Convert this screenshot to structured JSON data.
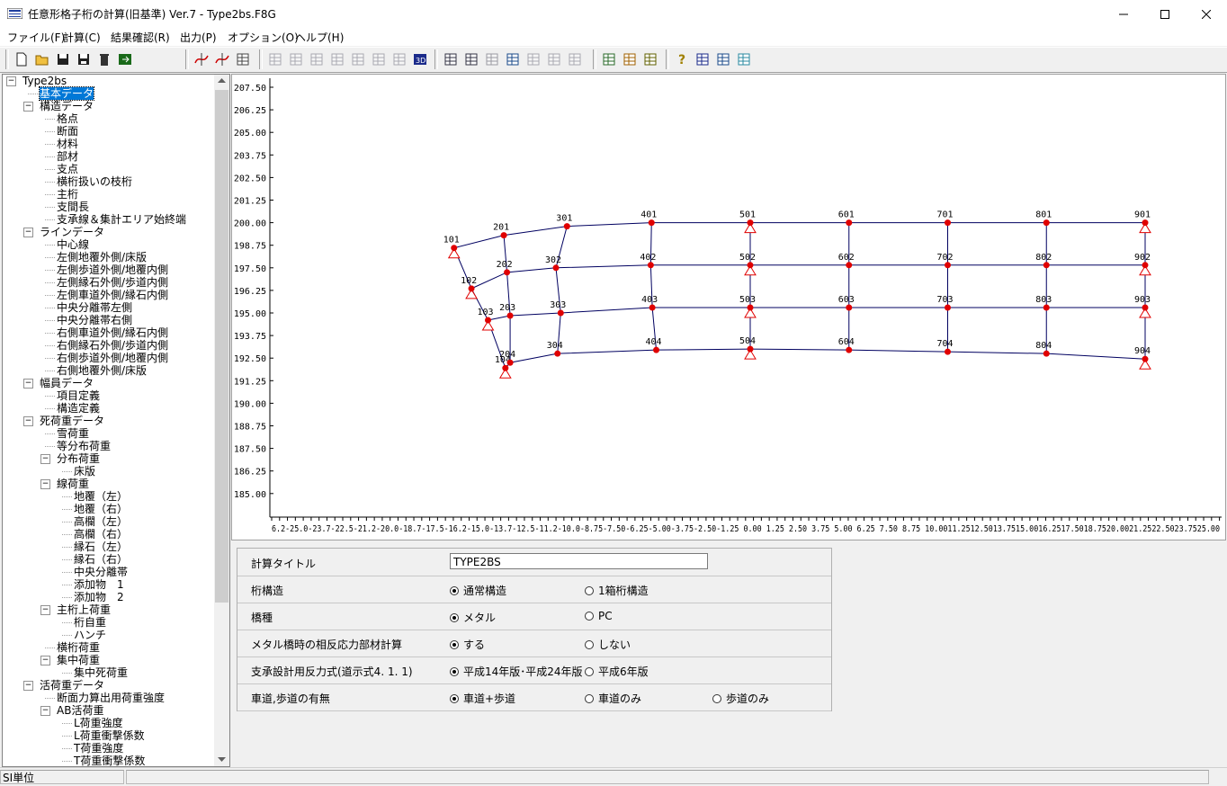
{
  "window": {
    "title": "任意形格子桁の計算(旧基準) Ver.7 - Type2bs.F8G",
    "minimize": "—",
    "maximize": "☐",
    "close": "✕"
  },
  "menu": [
    "ファイル(F)",
    "計算(C)",
    "結果確認(R)",
    "出力(P)",
    "オプション(O)",
    "ヘルプ(H)"
  ],
  "toolbar": {
    "groups": [
      [
        "new-file-icon",
        "open-folder-icon",
        "save-icon",
        "save-as-icon",
        "delete-icon",
        "exit-icon"
      ],
      [
        "spline-icon",
        "spline-edit-icon",
        "table-icon"
      ],
      [
        "grid-view-1-icon",
        "grid-view-2-icon",
        "grid-view-3-icon",
        "grid-view-4-icon",
        "grid-view-5-icon",
        "grid-view-6-icon",
        "frame-icon",
        "view-3d-icon"
      ],
      [
        "copy-icon",
        "print-preview-icon",
        "print-icon",
        "calc-result-icon",
        "chart-1-icon",
        "chart-2-icon",
        "chart-3-icon"
      ],
      [
        "check-icon",
        "calc-run-icon",
        "report-icon"
      ],
      [
        "help-icon",
        "book-icon",
        "card-icon",
        "grid-data-icon"
      ]
    ],
    "disabled": [
      "grid-view-1-icon",
      "grid-view-2-icon",
      "grid-view-3-icon",
      "grid-view-4-icon",
      "grid-view-5-icon",
      "grid-view-6-icon",
      "frame-icon",
      "print-icon",
      "chart-1-icon",
      "chart-2-icon",
      "chart-3-icon"
    ]
  },
  "tree": [
    {
      "label": "Type2bs",
      "level": 0,
      "box": "-"
    },
    {
      "label": "基本データ",
      "level": 1,
      "selected": true
    },
    {
      "label": "構造データ",
      "level": 1,
      "box": "-"
    },
    {
      "label": "格点",
      "level": 2
    },
    {
      "label": "断面",
      "level": 2
    },
    {
      "label": "材料",
      "level": 2
    },
    {
      "label": "部材",
      "level": 2
    },
    {
      "label": "支点",
      "level": 2
    },
    {
      "label": "横桁扱いの枝桁",
      "level": 2
    },
    {
      "label": "主桁",
      "level": 2
    },
    {
      "label": "支間長",
      "level": 2
    },
    {
      "label": "支承線＆集計エリア始終端",
      "level": 2
    },
    {
      "label": "ラインデータ",
      "level": 1,
      "box": "-"
    },
    {
      "label": "中心線",
      "level": 2
    },
    {
      "label": "左側地覆外側/床版",
      "level": 2
    },
    {
      "label": "左側歩道外側/地覆内側",
      "level": 2
    },
    {
      "label": "左側縁石外側/歩道内側",
      "level": 2
    },
    {
      "label": "左側車道外側/縁石内側",
      "level": 2
    },
    {
      "label": "中央分離帯左側",
      "level": 2
    },
    {
      "label": "中央分離帯右側",
      "level": 2
    },
    {
      "label": "右側車道外側/縁石内側",
      "level": 2
    },
    {
      "label": "右側縁石外側/歩道内側",
      "level": 2
    },
    {
      "label": "右側歩道外側/地覆内側",
      "level": 2
    },
    {
      "label": "右側地覆外側/床版",
      "level": 2
    },
    {
      "label": "幅員データ",
      "level": 1,
      "box": "-"
    },
    {
      "label": "項目定義",
      "level": 2
    },
    {
      "label": "構造定義",
      "level": 2
    },
    {
      "label": "死荷重データ",
      "level": 1,
      "box": "-"
    },
    {
      "label": "雪荷重",
      "level": 2
    },
    {
      "label": "等分布荷重",
      "level": 2
    },
    {
      "label": "分布荷重",
      "level": 2,
      "box": "-"
    },
    {
      "label": "床版",
      "level": 3
    },
    {
      "label": "線荷重",
      "level": 2,
      "box": "-"
    },
    {
      "label": "地覆（左）",
      "level": 3
    },
    {
      "label": "地覆（右）",
      "level": 3
    },
    {
      "label": "高欄（左）",
      "level": 3
    },
    {
      "label": "高欄（右）",
      "level": 3
    },
    {
      "label": "縁石（左）",
      "level": 3
    },
    {
      "label": "縁石（右）",
      "level": 3
    },
    {
      "label": "中央分離帯",
      "level": 3
    },
    {
      "label": "添加物　1",
      "level": 3
    },
    {
      "label": "添加物　2",
      "level": 3
    },
    {
      "label": "主桁上荷重",
      "level": 2,
      "box": "-"
    },
    {
      "label": "桁自重",
      "level": 3
    },
    {
      "label": "ハンチ",
      "level": 3
    },
    {
      "label": "横桁荷重",
      "level": 2
    },
    {
      "label": "集中荷重",
      "level": 2,
      "box": "-"
    },
    {
      "label": "集中死荷重",
      "level": 3
    },
    {
      "label": "活荷重データ",
      "level": 1,
      "box": "-"
    },
    {
      "label": "断面力算出用荷重強度",
      "level": 2
    },
    {
      "label": "AB活荷重",
      "level": 2,
      "box": "-"
    },
    {
      "label": "L荷重強度",
      "level": 3
    },
    {
      "label": "L荷重衝撃係数",
      "level": 3
    },
    {
      "label": "T荷重強度",
      "level": 3
    },
    {
      "label": "T荷重衝撃係数",
      "level": 3
    }
  ],
  "plot": {
    "y_ticks": [
      "207.50",
      "206.25",
      "205.00",
      "203.75",
      "202.50",
      "201.25",
      "200.00",
      "198.75",
      "197.50",
      "196.25",
      "195.00",
      "193.75",
      "192.50",
      "191.25",
      "190.00",
      "188.75",
      "187.50",
      "186.25",
      "185.00"
    ],
    "x_axis_text": "6.2-25.0-23.7-22.5-21.2-20.0-18.7-17.5-16.2-15.0-13.7-12.5-11.2-10.0-8.75-7.50-6.25-5.00-3.75-2.50-1.25 0.00  1.25  2.50  3.75  5.00  6.25  7.50  8.75 10.0011.2512.5013.7515.0016.2517.5018.7520.0021.2522.5023.7525.00",
    "nodes": [
      {
        "id": "101",
        "x": -18.75,
        "y": 198.6,
        "support": true
      },
      {
        "id": "201",
        "x": -15.6,
        "y": 199.3
      },
      {
        "id": "301",
        "x": -11.6,
        "y": 199.8
      },
      {
        "id": "401",
        "x": -6.25,
        "y": 200.0
      },
      {
        "id": "501",
        "x": 0.0,
        "y": 200.0,
        "support": true
      },
      {
        "id": "601",
        "x": 6.25,
        "y": 200.0
      },
      {
        "id": "701",
        "x": 12.5,
        "y": 200.0
      },
      {
        "id": "801",
        "x": 18.75,
        "y": 200.0
      },
      {
        "id": "901",
        "x": 25.0,
        "y": 200.0,
        "support": true
      },
      {
        "id": "102",
        "x": -17.65,
        "y": 196.35,
        "support": true
      },
      {
        "id": "202",
        "x": -15.4,
        "y": 197.25
      },
      {
        "id": "302",
        "x": -12.3,
        "y": 197.5
      },
      {
        "id": "402",
        "x": -6.3,
        "y": 197.65
      },
      {
        "id": "502",
        "x": 0.0,
        "y": 197.65,
        "support": true
      },
      {
        "id": "602",
        "x": 6.25,
        "y": 197.65
      },
      {
        "id": "702",
        "x": 12.5,
        "y": 197.65
      },
      {
        "id": "802",
        "x": 18.75,
        "y": 197.65
      },
      {
        "id": "902",
        "x": 25.0,
        "y": 197.65,
        "support": true
      },
      {
        "id": "103",
        "x": -16.6,
        "y": 194.6,
        "support": true
      },
      {
        "id": "203",
        "x": -15.2,
        "y": 194.85
      },
      {
        "id": "303",
        "x": -12.0,
        "y": 195.0
      },
      {
        "id": "403",
        "x": -6.2,
        "y": 195.3
      },
      {
        "id": "503",
        "x": 0.0,
        "y": 195.3,
        "support": true
      },
      {
        "id": "603",
        "x": 6.25,
        "y": 195.3
      },
      {
        "id": "703",
        "x": 12.5,
        "y": 195.3
      },
      {
        "id": "803",
        "x": 18.75,
        "y": 195.3
      },
      {
        "id": "903",
        "x": 25.0,
        "y": 195.3,
        "support": true
      },
      {
        "id": "104",
        "x": -15.5,
        "y": 191.95,
        "support": true
      },
      {
        "id": "204",
        "x": -15.2,
        "y": 192.25
      },
      {
        "id": "304",
        "x": -12.2,
        "y": 192.75
      },
      {
        "id": "404",
        "x": -5.95,
        "y": 192.95
      },
      {
        "id": "504",
        "x": 0.0,
        "y": 193.0,
        "support": true
      },
      {
        "id": "604",
        "x": 6.25,
        "y": 192.95
      },
      {
        "id": "704",
        "x": 12.5,
        "y": 192.85
      },
      {
        "id": "804",
        "x": 18.75,
        "y": 192.75
      },
      {
        "id": "904",
        "x": 25.0,
        "y": 192.45,
        "support": true
      }
    ]
  },
  "panel": {
    "title_label": "計算タイトル",
    "title_value": "TYPE2BS",
    "rows": [
      {
        "label": "桁構造",
        "options": [
          "通常構造",
          "1箱桁構造"
        ],
        "selected": 0
      },
      {
        "label": "橋種",
        "options": [
          "メタル",
          "PC"
        ],
        "selected": 0
      },
      {
        "label": "メタル橋時の相反応力部材計算",
        "options": [
          "する",
          "しない"
        ],
        "selected": 0
      },
      {
        "label": "支承設計用反力式(道示式4. 1. 1)",
        "options": [
          "平成14年版･平成24年版",
          "平成6年版"
        ],
        "selected": 0
      },
      {
        "label": "車道,歩道の有無",
        "options": [
          "車道+歩道",
          "車道のみ",
          "歩道のみ"
        ],
        "selected": 0
      }
    ]
  },
  "status": {
    "unit": "SI単位"
  },
  "colors": {
    "node": "#e00000",
    "line": "#000060",
    "support": "#e00000",
    "selection": "#0078d7"
  }
}
